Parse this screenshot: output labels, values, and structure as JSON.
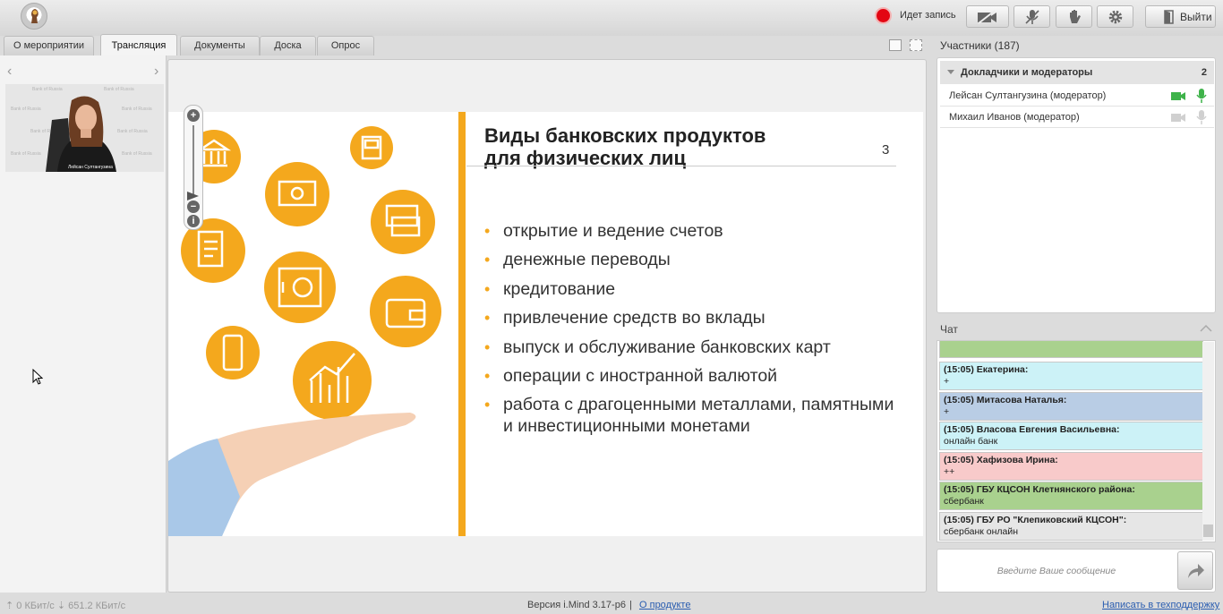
{
  "header": {
    "recording_text": "Идет запись",
    "exit_label": "Выйти"
  },
  "tabs": [
    {
      "label": "О мероприятии"
    },
    {
      "label": "Трансляция"
    },
    {
      "label": "Документы"
    },
    {
      "label": "Доска"
    },
    {
      "label": "Опрос"
    }
  ],
  "webcam": {
    "speaker_caption": "Лейсан Султангузина",
    "watermark": "Bank of Russia"
  },
  "slide": {
    "title_line1": "Виды банковских продуктов",
    "title_line2": "для физических лиц",
    "page_number": "3",
    "bullets": [
      "открытие и ведение счетов",
      "денежные переводы",
      "кредитование",
      "привлечение средств во вклады",
      "выпуск и обслуживание банковских карт",
      "операции с иностранной валютой",
      "работа с драгоценными металлами, памятными и инвестиционными монетами"
    ],
    "accent_color": "#f4a81d"
  },
  "zoom": {
    "plus": "+",
    "minus": "−",
    "info": "i"
  },
  "participants": {
    "title": "Участники (187)",
    "group_label": "Докладчики и модераторы",
    "group_count": "2",
    "people": [
      {
        "name": "Лейсан Султангузина (модератор)",
        "camera": "on"
      },
      {
        "name": "Михаил Иванов (модератор)",
        "camera": "off"
      }
    ]
  },
  "chat": {
    "title": "Чат",
    "messages": [
      {
        "author": "",
        "text": "+",
        "color": "#a9d18e"
      },
      {
        "author": "(15:05) Екатерина:",
        "text": "+",
        "color": "#ccf2f7"
      },
      {
        "author": "(15:05) Митасова Наталья:",
        "text": "+",
        "color": "#b9cde5"
      },
      {
        "author": "(15:05) Власова Евгения Васильевна:",
        "text": "онлайн банк",
        "color": "#ccf2f7"
      },
      {
        "author": "(15:05) Хафизова Ирина:",
        "text": "++",
        "color": "#f8caca"
      },
      {
        "author": "(15:05) ГБУ КЦСОН Клетнянского района:",
        "text": "сбербанк",
        "color": "#a9d18e"
      },
      {
        "author": "(15:05) ГБУ РО \"Клепиковский КЦСОН\":",
        "text": "сбербанк онлайн",
        "color": "#e6e6e6"
      }
    ],
    "input_placeholder": "Введите Ваше сообщение"
  },
  "footer": {
    "rates": "⇡ 0 КБит/с   ⇣ 651.2 КБит/с",
    "version": "Версия i.Mind 3.17-р6",
    "separator": "|",
    "about": "О продукте",
    "support": "Написать в техподдержку"
  }
}
